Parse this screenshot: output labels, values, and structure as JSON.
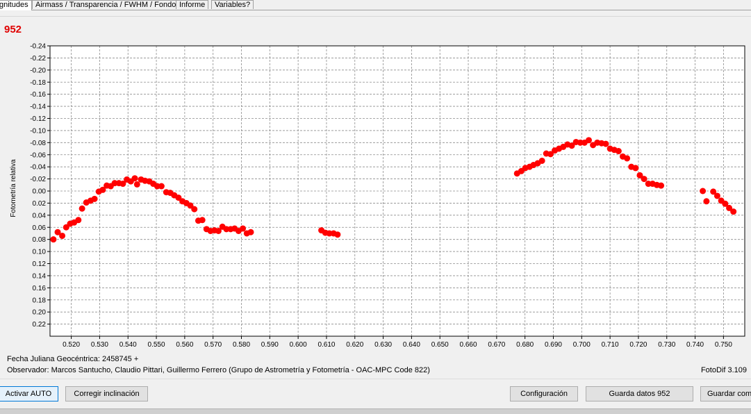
{
  "tabs": [
    {
      "label": "gnitudes",
      "active": true
    },
    {
      "label": "Airmass / Transparencia / FWHM / Fondo",
      "active": false
    },
    {
      "label": "Informe",
      "active": false
    },
    {
      "label": "Variables?",
      "active": false
    }
  ],
  "star_id": "952",
  "footer": {
    "julian_date": "Fecha Juliana Geocéntrica: 2458745 +",
    "observer": "Observador: Marcos Santucho, Claudio Pittari, Guillermo Ferrero (Grupo de Astrometría y Fotometría - OAC-MPC Code 822)",
    "version": "FotoDif 3.109"
  },
  "buttons": {
    "auto": "Activar AUTO",
    "tilt": "Corregir inclinación",
    "config": "Configuración",
    "save_data": "Guarda datos 952",
    "save_as": "Guardar como"
  },
  "chart_data": {
    "type": "scatter",
    "title": "",
    "xlabel": "",
    "ylabel": "Fotometría relativa",
    "xlim": [
      0.5125,
      0.7575
    ],
    "ylim": [
      -0.24,
      0.24
    ],
    "y_inverted": true,
    "grid": true,
    "marker_color": "#ff0000",
    "x_ticks": [
      0.52,
      0.53,
      0.54,
      0.55,
      0.56,
      0.57,
      0.58,
      0.59,
      0.6,
      0.61,
      0.62,
      0.63,
      0.64,
      0.65,
      0.66,
      0.67,
      0.68,
      0.69,
      0.7,
      0.71,
      0.72,
      0.73,
      0.74,
      0.75
    ],
    "x_tick_labels": [
      "0.520",
      "0.530",
      "0.540",
      "0.550",
      "0.560",
      "0.570",
      "0.580",
      "0.590",
      "0.600",
      "0.610",
      "0.620",
      "0.630",
      "0.640",
      "0.650",
      "0.660",
      "0.670",
      "0.680",
      "0.690",
      "0.700",
      "0.710",
      "0.720",
      "0.730",
      "0.740",
      "0.750"
    ],
    "y_ticks": [
      -0.24,
      -0.22,
      -0.2,
      -0.18,
      -0.16,
      -0.14,
      -0.12,
      -0.1,
      -0.08,
      -0.06,
      -0.04,
      -0.02,
      0.0,
      0.02,
      0.04,
      0.06,
      0.08,
      0.1,
      0.12,
      0.14,
      0.16,
      0.18,
      0.2,
      0.22
    ],
    "y_tick_labels": [
      "-0.24",
      "-0.22",
      "-0.20",
      "-0.18",
      "-0.16",
      "-0.14",
      "-0.12",
      "-0.10",
      "-0.08",
      "-0.06",
      "-0.04",
      "-0.02",
      "0.00",
      "0.02",
      "0.04",
      "0.06",
      "0.08",
      "0.10",
      "0.12",
      "0.14",
      "0.16",
      "0.18",
      "0.20",
      "0.22"
    ],
    "points": [
      [
        0.5137,
        0.08
      ],
      [
        0.5152,
        0.068
      ],
      [
        0.5168,
        0.074
      ],
      [
        0.5182,
        0.06
      ],
      [
        0.5196,
        0.054
      ],
      [
        0.521,
        0.052
      ],
      [
        0.5225,
        0.048
      ],
      [
        0.5238,
        0.029
      ],
      [
        0.5253,
        0.019
      ],
      [
        0.5268,
        0.016
      ],
      [
        0.5282,
        0.013
      ],
      [
        0.5297,
        0.001
      ],
      [
        0.5311,
        -0.002
      ],
      [
        0.5325,
        -0.009
      ],
      [
        0.5339,
        -0.008
      ],
      [
        0.5353,
        -0.013
      ],
      [
        0.5368,
        -0.013
      ],
      [
        0.5382,
        -0.012
      ],
      [
        0.5396,
        -0.019
      ],
      [
        0.541,
        -0.016
      ],
      [
        0.5424,
        -0.021
      ],
      [
        0.5432,
        -0.011
      ],
      [
        0.5446,
        -0.019
      ],
      [
        0.546,
        -0.017
      ],
      [
        0.5475,
        -0.016
      ],
      [
        0.5489,
        -0.012
      ],
      [
        0.5503,
        -0.008
      ],
      [
        0.5518,
        -0.008
      ],
      [
        0.5535,
        0.002
      ],
      [
        0.5549,
        0.003
      ],
      [
        0.5563,
        0.007
      ],
      [
        0.5578,
        0.011
      ],
      [
        0.5592,
        0.017
      ],
      [
        0.5606,
        0.02
      ],
      [
        0.562,
        0.024
      ],
      [
        0.5634,
        0.03
      ],
      [
        0.5648,
        0.049
      ],
      [
        0.5662,
        0.048
      ],
      [
        0.5677,
        0.063
      ],
      [
        0.5691,
        0.066
      ],
      [
        0.5705,
        0.065
      ],
      [
        0.5719,
        0.066
      ],
      [
        0.5733,
        0.059
      ],
      [
        0.5747,
        0.063
      ],
      [
        0.5762,
        0.063
      ],
      [
        0.5776,
        0.062
      ],
      [
        0.579,
        0.066
      ],
      [
        0.5805,
        0.062
      ],
      [
        0.5819,
        0.07
      ],
      [
        0.5833,
        0.068
      ],
      [
        0.6082,
        0.065
      ],
      [
        0.6096,
        0.069
      ],
      [
        0.611,
        0.07
      ],
      [
        0.6125,
        0.07
      ],
      [
        0.6139,
        0.072
      ],
      [
        0.6772,
        -0.029
      ],
      [
        0.6787,
        -0.033
      ],
      [
        0.6801,
        -0.038
      ],
      [
        0.6816,
        -0.04
      ],
      [
        0.683,
        -0.043
      ],
      [
        0.6845,
        -0.046
      ],
      [
        0.686,
        -0.05
      ],
      [
        0.6875,
        -0.062
      ],
      [
        0.689,
        -0.061
      ],
      [
        0.6905,
        -0.067
      ],
      [
        0.692,
        -0.07
      ],
      [
        0.6935,
        -0.073
      ],
      [
        0.695,
        -0.077
      ],
      [
        0.6965,
        -0.075
      ],
      [
        0.698,
        -0.081
      ],
      [
        0.6995,
        -0.08
      ],
      [
        0.701,
        -0.08
      ],
      [
        0.7025,
        -0.084
      ],
      [
        0.704,
        -0.076
      ],
      [
        0.7055,
        -0.08
      ],
      [
        0.707,
        -0.079
      ],
      [
        0.7085,
        -0.078
      ],
      [
        0.71,
        -0.07
      ],
      [
        0.7115,
        -0.068
      ],
      [
        0.713,
        -0.066
      ],
      [
        0.7145,
        -0.057
      ],
      [
        0.716,
        -0.054
      ],
      [
        0.7175,
        -0.04
      ],
      [
        0.719,
        -0.038
      ],
      [
        0.7205,
        -0.026
      ],
      [
        0.722,
        -0.02
      ],
      [
        0.7235,
        -0.012
      ],
      [
        0.725,
        -0.012
      ],
      [
        0.7265,
        -0.01
      ],
      [
        0.728,
        -0.009
      ],
      [
        0.7427,
        0.0
      ],
      [
        0.744,
        0.017
      ],
      [
        0.7464,
        0.001
      ],
      [
        0.7478,
        0.008
      ],
      [
        0.7492,
        0.016
      ],
      [
        0.7506,
        0.021
      ],
      [
        0.752,
        0.028
      ],
      [
        0.7535,
        0.034
      ]
    ]
  }
}
